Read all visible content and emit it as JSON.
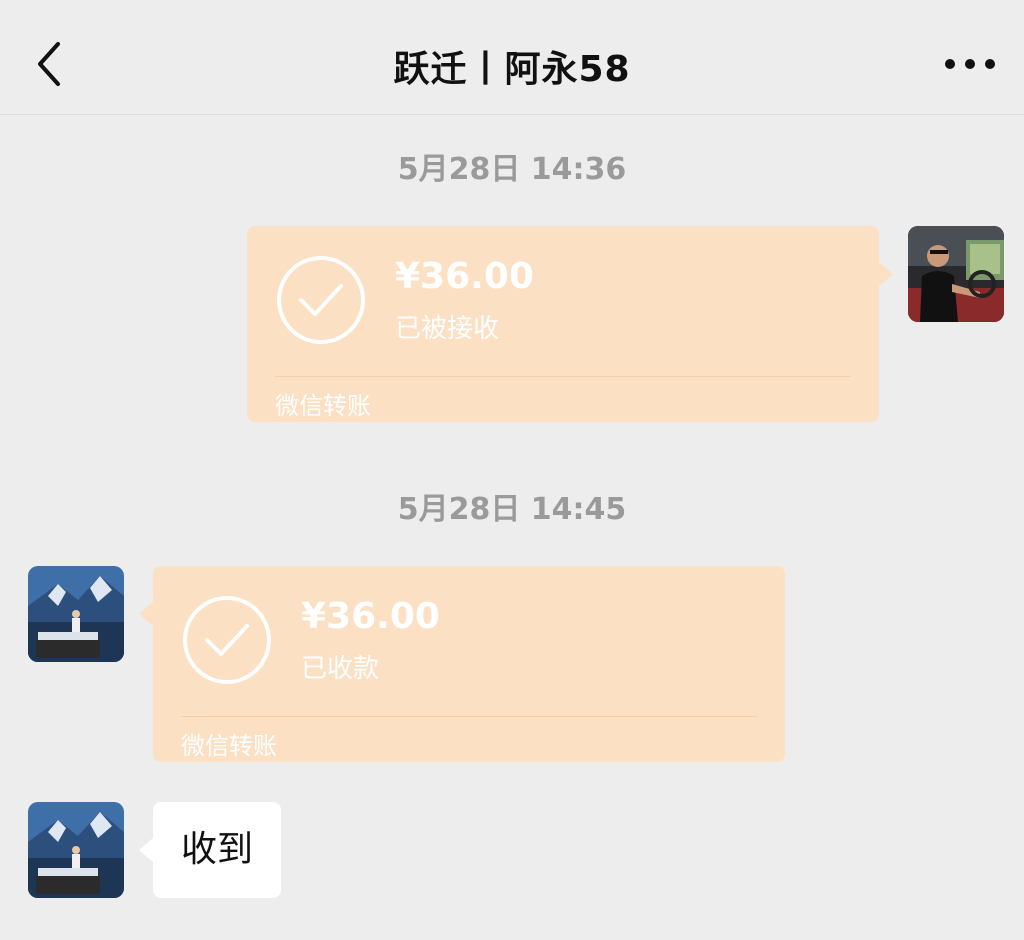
{
  "header": {
    "title": "跃迁丨阿永58"
  },
  "messages": [
    {
      "timestamp": "5月28日 14:36",
      "amount": "¥36.00",
      "status": "已被接收",
      "label": "微信转账"
    },
    {
      "timestamp": "5月28日 14:45",
      "amount": "¥36.00",
      "status": "已收款",
      "label": "微信转账"
    },
    {
      "text": "收到"
    }
  ],
  "colors": {
    "transfer_bg": "#fbe0c4",
    "page_bg": "#ededed"
  }
}
